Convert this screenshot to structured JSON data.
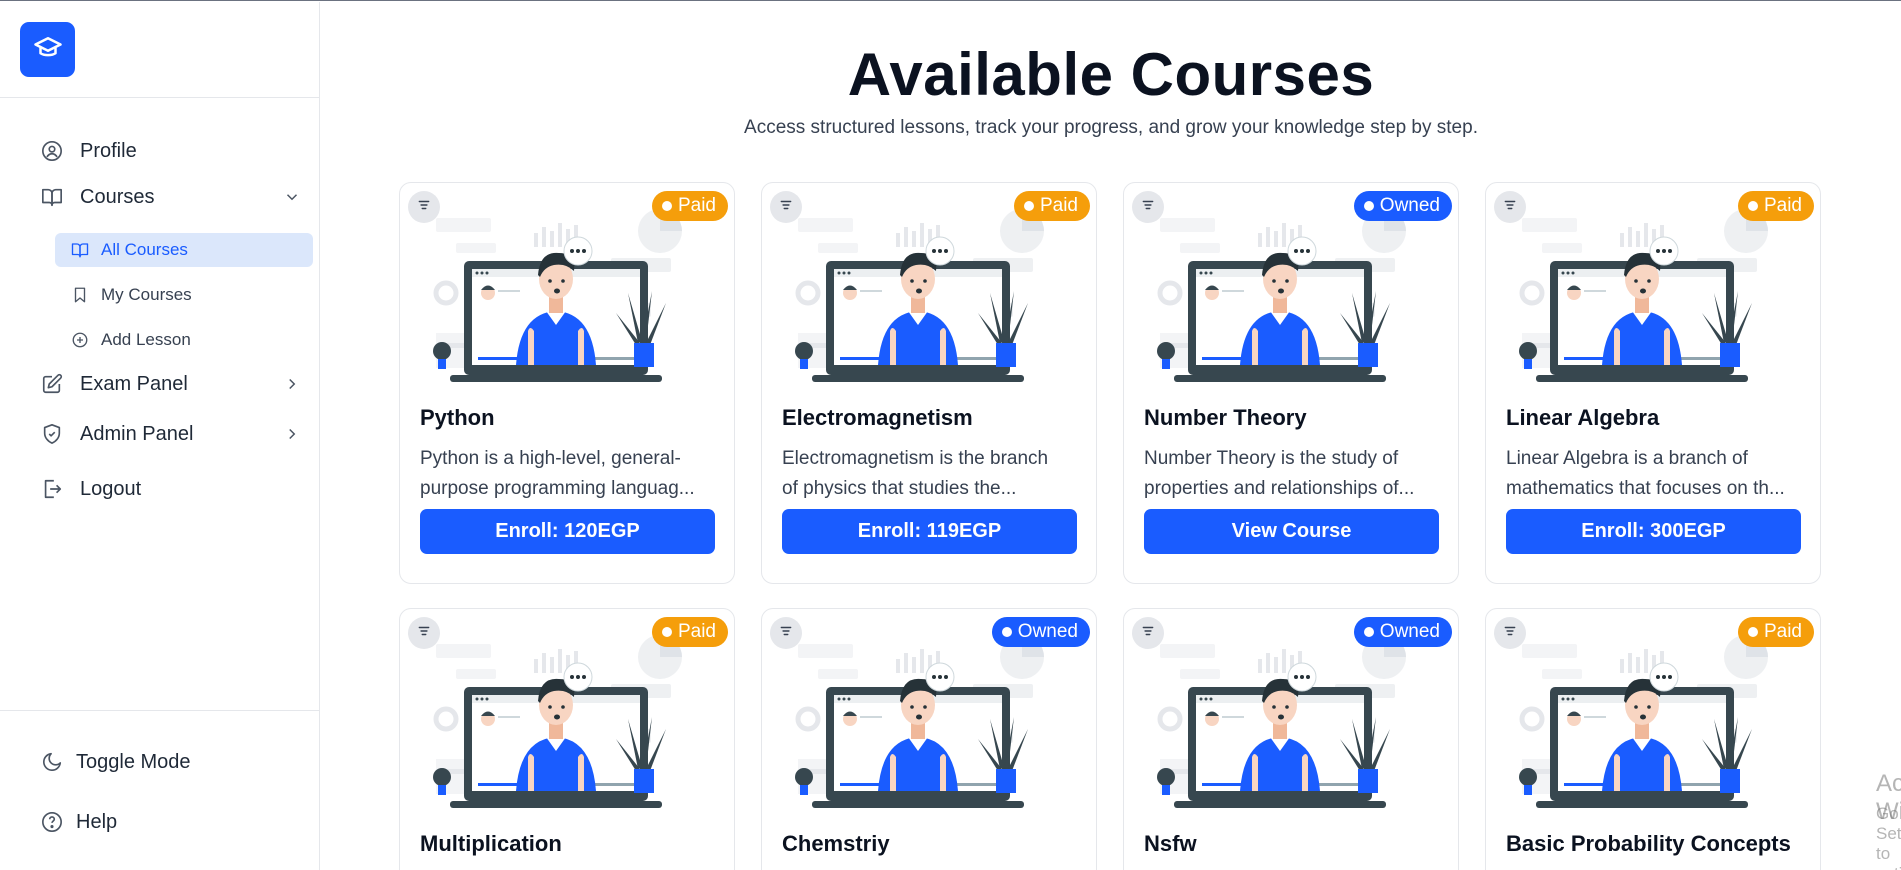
{
  "sidebar": {
    "logo_icon": "graduation-cap-icon",
    "items": [
      {
        "label": "Profile",
        "icon": "user-circle-icon"
      },
      {
        "label": "Courses",
        "icon": "book-open-icon"
      },
      {
        "label": "Exam Panel",
        "icon": "edit-icon"
      },
      {
        "label": "Admin Panel",
        "icon": "shield-check-icon"
      },
      {
        "label": "Logout",
        "icon": "logout-icon"
      }
    ],
    "sub_items": [
      {
        "label": "All Courses",
        "icon": "book-open-icon",
        "active": true
      },
      {
        "label": "My Courses",
        "icon": "bookmark-icon"
      },
      {
        "label": "Add Lesson",
        "icon": "plus-circle-icon"
      }
    ],
    "bottom": [
      {
        "label": "Toggle Mode",
        "icon": "moon-icon"
      },
      {
        "label": "Help",
        "icon": "help-circle-icon"
      }
    ]
  },
  "main": {
    "title": "Available Courses",
    "subtitle": "Access structured lessons, track your progress, and grow your knowledge step by step.",
    "courses": [
      {
        "title": "Python",
        "badge": "Paid",
        "desc1": "Python is a high-level, general-",
        "desc2": "purpose programming languag...",
        "button": "Enroll: 120EGP"
      },
      {
        "title": "Electromagnetism",
        "badge": "Paid",
        "desc1": "Electromagnetism is the branch",
        "desc2": "of physics that studies the...",
        "button": "Enroll: 119EGP"
      },
      {
        "title": "Number Theory",
        "badge": "Owned",
        "desc1": "Number Theory is the study of",
        "desc2": "properties and relationships of...",
        "button": "View Course"
      },
      {
        "title": "Linear Algebra",
        "badge": "Paid",
        "desc1": "Linear Algebra is a branch of",
        "desc2": "mathematics that focuses on th...",
        "button": "Enroll: 300EGP"
      },
      {
        "title": "Multiplication",
        "badge": "Paid"
      },
      {
        "title": "Chemstriy",
        "badge": "Owned"
      },
      {
        "title": "Nsfw",
        "badge": "Owned"
      },
      {
        "title": "Basic Probability Concepts",
        "badge": "Paid"
      }
    ]
  },
  "watermark": {
    "line1": "Activate Windows",
    "line2": "Go to Settings to activate Windows."
  },
  "colors": {
    "accent": "#1a5cff",
    "paid": "#f59e0b",
    "active_bg": "#dbe7fb"
  }
}
